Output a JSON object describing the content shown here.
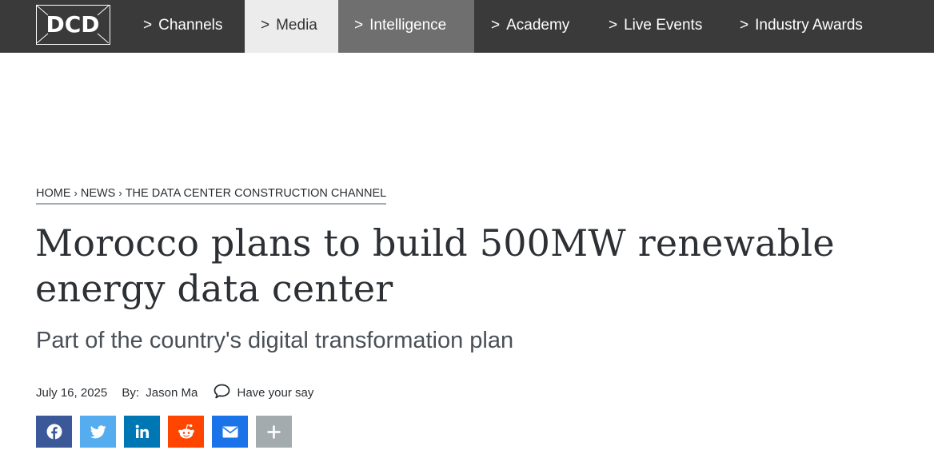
{
  "header": {
    "logo_text": "DCD",
    "nav": [
      {
        "chevron": ">",
        "label": "Channels"
      },
      {
        "chevron": ">",
        "label": "Media"
      },
      {
        "chevron": ">",
        "label": "Intelligence"
      },
      {
        "chevron": ">",
        "label": "Academy"
      },
      {
        "chevron": ">",
        "label": "Live Events"
      },
      {
        "chevron": ">",
        "label": "Industry Awards"
      }
    ]
  },
  "breadcrumb": {
    "items": [
      "HOME",
      "NEWS",
      "THE DATA CENTER CONSTRUCTION CHANNEL"
    ],
    "separator": "›"
  },
  "article": {
    "title": "Morocco plans to build 500MW renewable energy data center",
    "subtitle": "Part of the country's digital transformation plan",
    "date": "July 16, 2025",
    "by_label": "By:",
    "author": "Jason Ma",
    "comment_label": "Have your say"
  },
  "share": [
    {
      "name": "facebook-icon",
      "color": "#3b5998"
    },
    {
      "name": "twitter-icon",
      "color": "#55acee"
    },
    {
      "name": "linkedin-icon",
      "color": "#0077b5"
    },
    {
      "name": "reddit-icon",
      "color": "#ff4500"
    },
    {
      "name": "email-icon",
      "color": "#1a73e8"
    },
    {
      "name": "plus-icon",
      "color": "#a4abae"
    }
  ],
  "colors": {
    "nav_bg": "#3a3a3a",
    "nav_active_bg": "#ececec",
    "nav_hover_bg": "#6f6f6f"
  }
}
